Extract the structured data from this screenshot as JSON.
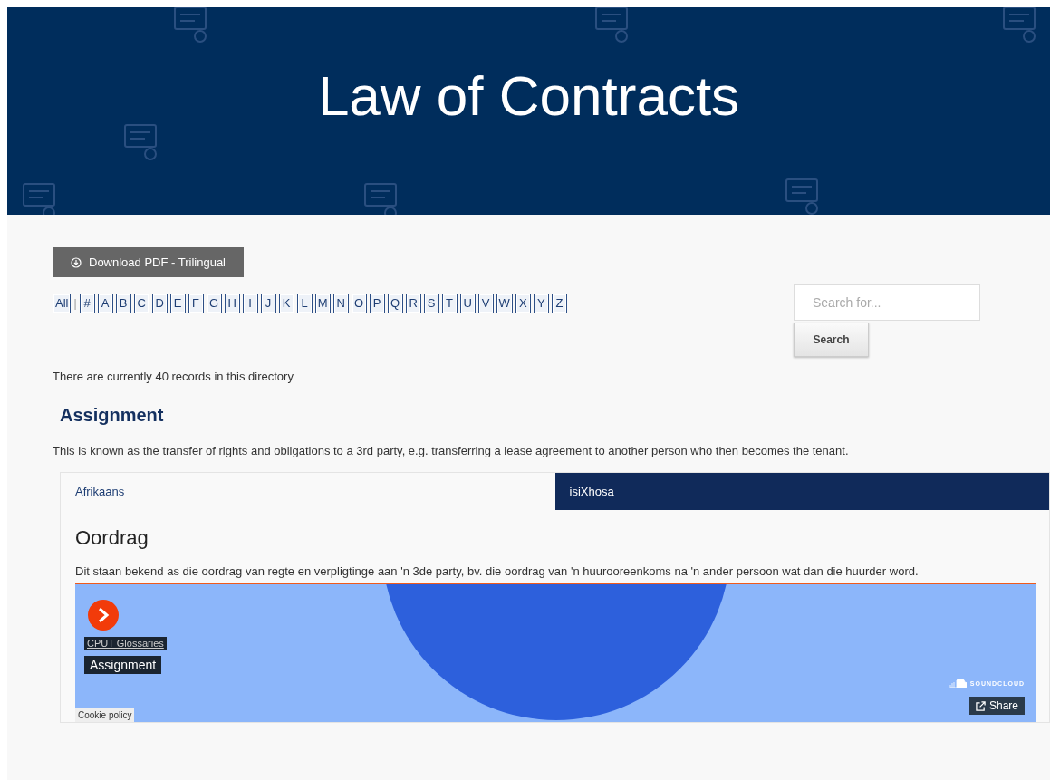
{
  "header": {
    "title": "Law of Contracts"
  },
  "download_button": {
    "label": "Download PDF - Trilingual"
  },
  "alphabet": {
    "all": "All",
    "separator": "|",
    "letters": [
      "#",
      "A",
      "B",
      "C",
      "D",
      "E",
      "F",
      "G",
      "H",
      "I",
      "J",
      "K",
      "L",
      "M",
      "N",
      "O",
      "P",
      "Q",
      "R",
      "S",
      "T",
      "U",
      "V",
      "W",
      "X",
      "Y",
      "Z"
    ]
  },
  "search": {
    "placeholder": "Search for...",
    "button": "Search"
  },
  "record_count": "There are currently 40 records in this directory",
  "entry": {
    "term": "Assignment",
    "definition": "This is known as the transfer of rights and obligations to a 3rd party, e.g. transferring a lease agreement to another person who then becomes the tenant.",
    "tabs": [
      {
        "label": "Afrikaans",
        "selected": true
      },
      {
        "label": "isiXhosa",
        "selected": false
      }
    ],
    "translation": {
      "term": "Oordrag",
      "definition": "Dit staan bekend as die oordrag van regte en verpligtinge aan 'n 3de party, bv. die oordrag van 'n huurooreenkoms na 'n ander persoon wat dan die huurder word."
    },
    "player": {
      "user": "CPUT Glossaries",
      "track": "Assignment",
      "brand": "SOUNDCLOUD",
      "share": "Share",
      "cookie": "Cookie policy"
    }
  }
}
